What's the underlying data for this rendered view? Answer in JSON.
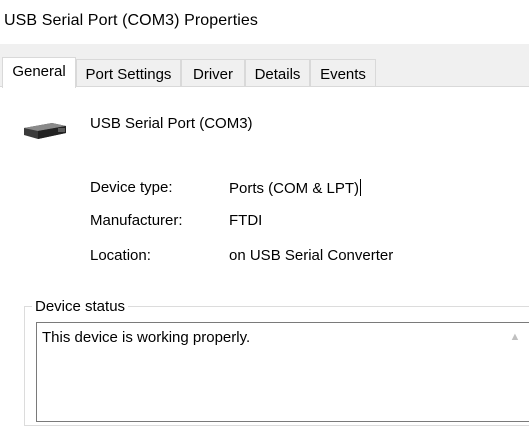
{
  "window": {
    "title": "USB Serial Port (COM3) Properties"
  },
  "tabs": [
    {
      "label": "General",
      "active": true
    },
    {
      "label": "Port Settings",
      "active": false
    },
    {
      "label": "Driver",
      "active": false
    },
    {
      "label": "Details",
      "active": false
    },
    {
      "label": "Events",
      "active": false
    }
  ],
  "device": {
    "icon": "serial-port-connector-icon",
    "name": "USB Serial Port (COM3)"
  },
  "properties": [
    {
      "label": "Device type:",
      "value": "Ports (COM & LPT)"
    },
    {
      "label": "Manufacturer:",
      "value": "FTDI"
    },
    {
      "label": "Location:",
      "value": "on USB Serial Converter"
    }
  ],
  "status_group": {
    "legend": "Device status",
    "text": "This device is working properly."
  },
  "colors": {
    "tab_border": "#d9d9d9",
    "dialog_bg": "#f0f0f0",
    "text": "#000000"
  }
}
